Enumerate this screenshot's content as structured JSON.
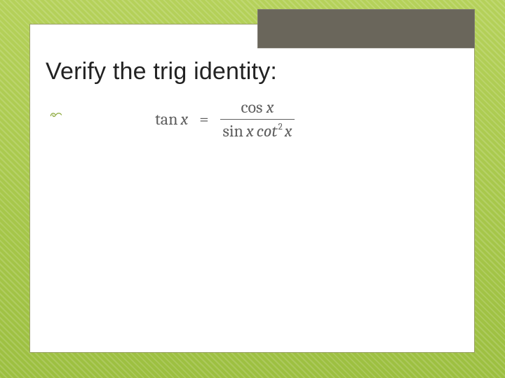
{
  "title": "Verify the trig identity:",
  "bullet": {
    "icon": "swirl-icon"
  },
  "formula": {
    "lhs_func": "tan",
    "lhs_var": "x",
    "equals": "=",
    "numerator_func": "cos",
    "numerator_var": "x",
    "denom_func1": "sin",
    "denom_var1": "x",
    "denom_func2": "cot",
    "denom_exp": "2",
    "denom_var2": "x"
  },
  "colors": {
    "accent_green": "#a8c84c",
    "banner_gray": "#6a665b",
    "math_gray": "#5f5f5f"
  }
}
